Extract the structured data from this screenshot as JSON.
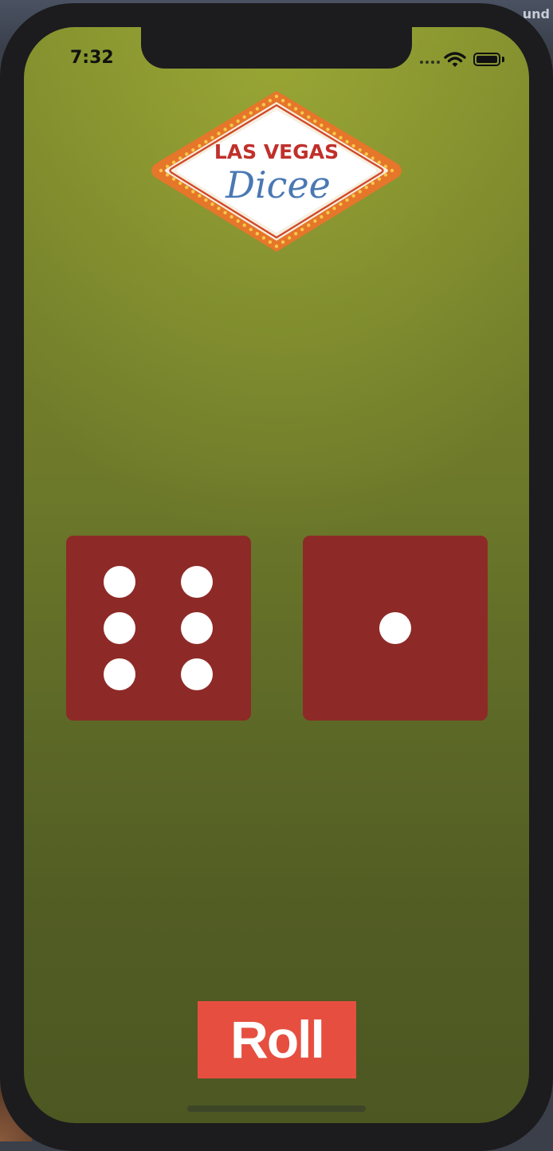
{
  "background": {
    "corner_text": "und"
  },
  "status_bar": {
    "time": "7:32",
    "battery_level": 1.0,
    "icons": [
      "cellular-signal-icon",
      "wifi-icon",
      "battery-icon"
    ]
  },
  "logo": {
    "top_text": "LAS VEGAS",
    "script_text": "Dicee"
  },
  "dice": {
    "left_value": 6,
    "right_value": 1
  },
  "roll_button": {
    "label": "Roll"
  },
  "colors": {
    "felt_green": "#6e7a2a",
    "dice_red": "#8d2a27",
    "pip_white": "#ffffff",
    "roll_button": "#e64f40",
    "logo_red": "#c0302b",
    "logo_blue": "#4a78b4",
    "logo_orange": "#e5762a",
    "marquee_bulb": "#f6c84a"
  }
}
